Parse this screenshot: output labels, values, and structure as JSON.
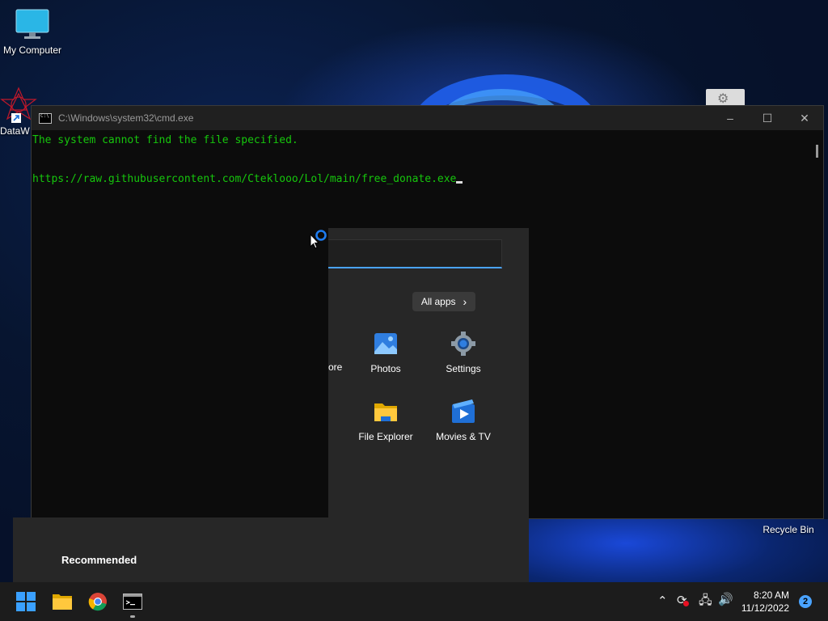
{
  "desktop": {
    "icons": [
      {
        "label": "My Computer"
      },
      {
        "label": "DataW"
      },
      {
        "label": "Recycle Bin"
      }
    ]
  },
  "cmd": {
    "title": "C:\\Windows\\system32\\cmd.exe",
    "lines": [
      "The system cannot find the file specified.",
      "",
      "https://raw.githubusercontent.com/Cteklooo/Lol/main/free_donate.exe"
    ],
    "text_color": "#16c60c"
  },
  "start_menu": {
    "all_apps_label": "All apps",
    "pinned": [
      {
        "label": "ore",
        "icon": "store-icon"
      },
      {
        "label": "Photos",
        "icon": "photos-icon"
      },
      {
        "label": "Settings",
        "icon": "gear-icon"
      },
      {
        "label": "File Explorer",
        "icon": "folder-icon"
      },
      {
        "label": "Movies & TV",
        "icon": "movies-icon"
      }
    ],
    "recommended_label": "Recommended",
    "accent": "#4aa3ff"
  },
  "taskbar": {
    "apps": [
      "start-icon",
      "file-explorer-icon",
      "chrome-icon",
      "cmd-icon"
    ],
    "clock_time": "8:20 AM",
    "clock_date": "11/12/2022",
    "notification_count": "2"
  }
}
